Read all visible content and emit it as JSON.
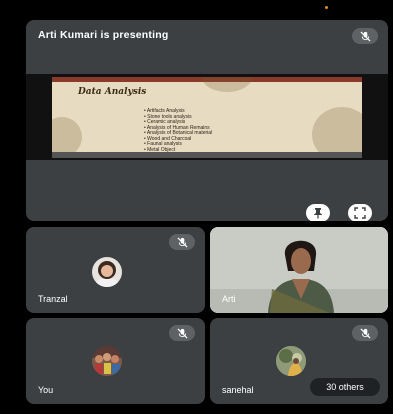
{
  "presenter_banner": "Arti Kumari is presenting",
  "slide": {
    "title": "Data Analysis",
    "bullets": [
      "Artifacts Analysis",
      "Stone tools analysis",
      "Ceramic analysis",
      "Analysis of Human Remains",
      "Analysis of Botanical material",
      "Wood and Charcoal",
      "Faunal analysis",
      "Metal Object"
    ]
  },
  "controls": {
    "pin_icon": "pin-icon",
    "fullscreen_icon": "fullscreen-icon"
  },
  "participants": [
    {
      "name": "Tranzal"
    },
    {
      "name": "Arti"
    },
    {
      "name": "You"
    },
    {
      "name": "sanehal"
    }
  ],
  "others_label": "30 others",
  "colors": {
    "background": "#000000",
    "tile": "#3c4043",
    "chip": "#202124"
  }
}
